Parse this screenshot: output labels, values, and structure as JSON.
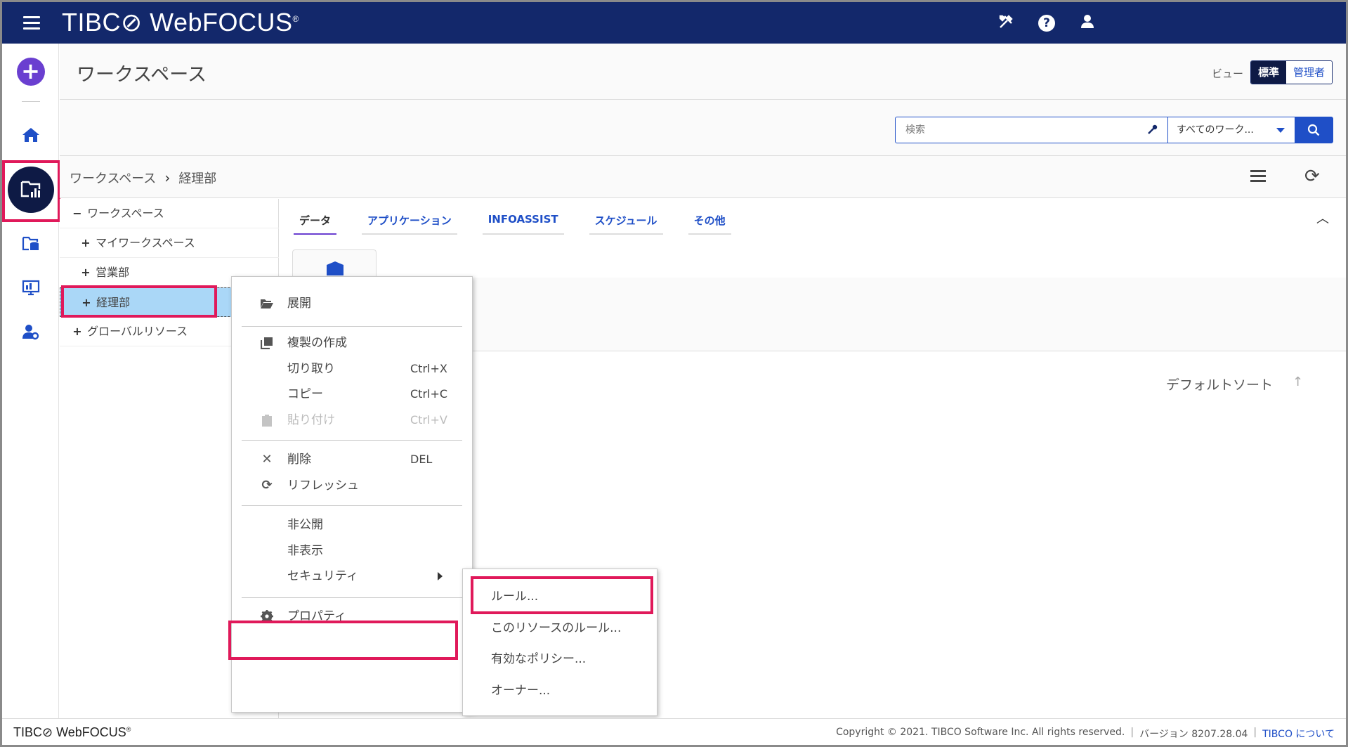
{
  "app": {
    "brand": "TIBC⊘ WebFOCUS",
    "brand_mark": "®"
  },
  "header": {
    "title": "ワークスペース",
    "view_label": "ビュー",
    "view_standard": "標準",
    "view_admin": "管理者"
  },
  "search": {
    "placeholder": "検索",
    "scope": "すべてのワーク..."
  },
  "breadcrumb": {
    "root": "ワークスペース",
    "current": "経理部"
  },
  "tree": {
    "items": [
      {
        "toggle": "−",
        "label": "ワークスペース"
      },
      {
        "toggle": "+",
        "label": "マイワークスペース"
      },
      {
        "toggle": "+",
        "label": "営業部"
      },
      {
        "toggle": "+",
        "label": "経理部"
      },
      {
        "toggle": "+",
        "label": "グローバルリソース"
      }
    ]
  },
  "tabs": [
    {
      "label": "データ"
    },
    {
      "label": "アプリケーション"
    },
    {
      "label": "INFOASSIST"
    },
    {
      "label": "スケジュール"
    },
    {
      "label": "その他"
    }
  ],
  "sort": {
    "label": "デフォルトソート"
  },
  "context_menu": {
    "expand": "展開",
    "duplicate": "複製の作成",
    "cut": "切り取り",
    "cut_shortcut": "Ctrl+X",
    "copy": "コピー",
    "copy_shortcut": "Ctrl+C",
    "paste": "貼り付け",
    "paste_shortcut": "Ctrl+V",
    "delete": "削除",
    "delete_shortcut": "DEL",
    "refresh": "リフレッシュ",
    "unpublish": "非公開",
    "hide": "非表示",
    "security": "セキュリティ",
    "properties": "プロパティ"
  },
  "security_submenu": {
    "rules": "ルール...",
    "resource_rules": "このリソースのルール...",
    "effective_policy": "有効なポリシー...",
    "owner": "オーナー..."
  },
  "footer": {
    "brand": "TIBC⊘ WebFOCUS",
    "brand_mark": "®",
    "copyright": "Copyright © 2021. TIBCO Software Inc. All rights reserved.",
    "version": "バージョン 8207.28.04",
    "about": "TIBCO について"
  }
}
